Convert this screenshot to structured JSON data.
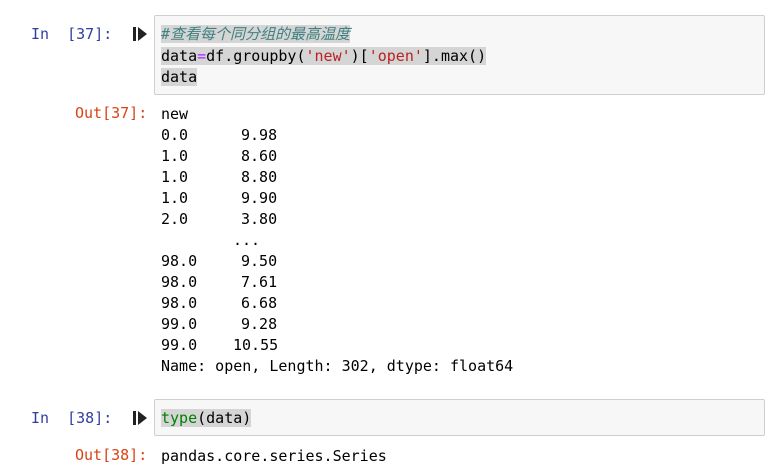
{
  "cell37": {
    "in_prompt": "In  [37]:",
    "comment": "#查看每个同分组的最高温度",
    "line2": {
      "var": "data",
      "eq": "=",
      "call1": "df.groupby(",
      "str1": "'new'",
      "mid": ")[",
      "str2": "'open'",
      "call2": "].max()"
    },
    "line3": "data",
    "out_prompt": "Out[37]:",
    "output": {
      "header": "new",
      "rows": [
        {
          "idx": "0.0",
          "val": "9.98"
        },
        {
          "idx": "1.0",
          "val": "8.60"
        },
        {
          "idx": "1.0",
          "val": "8.80"
        },
        {
          "idx": "1.0",
          "val": "9.90"
        },
        {
          "idx": "2.0",
          "val": "3.80"
        }
      ],
      "ellipsis": "...",
      "rows2": [
        {
          "idx": "98.0",
          "val": "9.50"
        },
        {
          "idx": "98.0",
          "val": "7.61"
        },
        {
          "idx": "98.0",
          "val": "6.68"
        },
        {
          "idx": "99.0",
          "val": "9.28"
        },
        {
          "idx": "99.0",
          "val": "10.55"
        }
      ],
      "footer": "Name: open, Length: 302, dtype: float64"
    }
  },
  "cell38": {
    "in_prompt": "In  [38]:",
    "code_builtin": "type",
    "code_rest": "(data)",
    "out_prompt": "Out[38]:",
    "output": "pandas.core.series.Series"
  },
  "icons": {
    "run": "run-cell-icon"
  },
  "colors": {
    "in_prompt": "#303f9f",
    "out_prompt": "#d84315",
    "comment": "#408080",
    "string": "#ba2121",
    "builtin": "#008000"
  }
}
